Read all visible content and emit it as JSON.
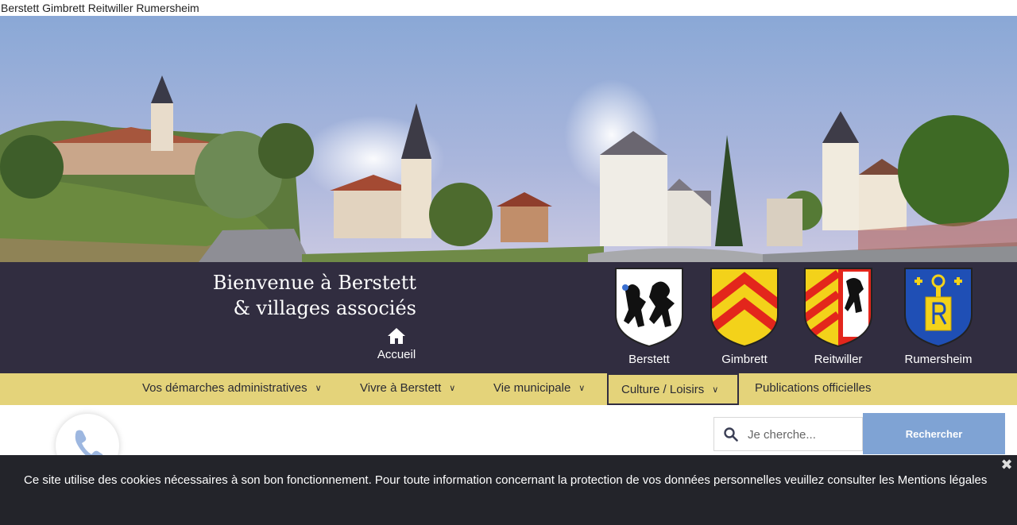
{
  "site_title": "Berstett Gimbrett Reitwiller Rumersheim",
  "header": {
    "welcome_line1": "Bienvenue à Berstett",
    "welcome_line2": "& villages associés",
    "home_label": "Accueil"
  },
  "crests": [
    {
      "name": "Berstett",
      "icon": "berstett-crest-icon"
    },
    {
      "name": "Gimbrett",
      "icon": "gimbrett-crest-icon"
    },
    {
      "name": "Reitwiller",
      "icon": "reitwiller-crest-icon"
    },
    {
      "name": "Rumersheim",
      "icon": "rumersheim-crest-icon"
    }
  ],
  "nav": {
    "items": [
      {
        "label": "Vos démarches administratives",
        "has_dropdown": true
      },
      {
        "label": "Vivre à Berstett",
        "has_dropdown": true
      },
      {
        "label": "Vie municipale",
        "has_dropdown": true
      },
      {
        "label": "Culture / Loisirs",
        "has_dropdown": true,
        "active": true
      },
      {
        "label": "Publications officielles",
        "has_dropdown": false
      }
    ]
  },
  "search": {
    "placeholder": "Je cherche...",
    "button_label": "Rechercher"
  },
  "cookie": {
    "message": "Ce site utilise des cookies nécessaires à son bon fonctionnement. Pour toute information concernant la protection de vos données personnelles veuillez consulter les Mentions légales",
    "close_symbol": "✖"
  },
  "colors": {
    "band": "#312d40",
    "nav": "#e4d37a",
    "search_button": "#7fa3d4",
    "cookie_bar": "#23242a"
  }
}
